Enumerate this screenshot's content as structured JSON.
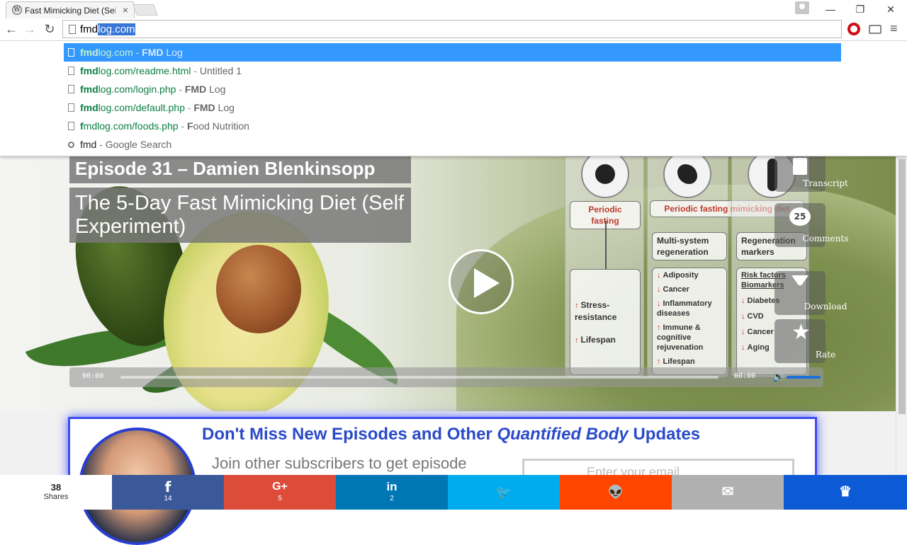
{
  "browser": {
    "tab_title": "Fast Mimicking Diet (Self-",
    "tab_close": "×",
    "favicon_letter": "W",
    "window": {
      "minimize": "—",
      "restore": "❐",
      "close": "✕"
    },
    "nav": {
      "back": "←",
      "forward": "→",
      "reload": "↻"
    },
    "address": {
      "typed": "fmd",
      "completion": "log.com"
    },
    "menu": "≡"
  },
  "suggestions": [
    {
      "bold": "fmd",
      "url_rest": "log.com",
      "sep": " - ",
      "title_bold": "FMD",
      "title_rest": " Log",
      "selected": true
    },
    {
      "bold": "fmd",
      "url_rest": "log.com/readme.html",
      "sep": " - ",
      "title_bold": "",
      "title_rest": "Untitled 1"
    },
    {
      "bold": "fmd",
      "url_rest": "log.com/login.php",
      "sep": " - ",
      "title_bold": "FMD",
      "title_rest": " Log"
    },
    {
      "bold": "fmd",
      "url_rest": "log.com/default.php",
      "sep": " - ",
      "title_bold": "FMD",
      "title_rest": " Log"
    },
    {
      "bold": "f",
      "url_rest": "mdlog.com/foods.php",
      "sep": " - ",
      "title_bold": "F",
      "title_rest": "ood Nutrition"
    }
  ],
  "search_suggestion": {
    "query": "fmd",
    "label": " - Google Search"
  },
  "hero": {
    "episode": "Episode 31 – Damien Blenkinsopp",
    "subtitle": "The 5-Day Fast Mimicking Diet (Self Experiment)",
    "diagram": {
      "col1_head": "Periodic fasting",
      "col23_head": "Periodic fasting mimicking diet",
      "col2_box1": "Multi-system regeneration",
      "col3_box1": "Regeneration markers",
      "col1_items": [
        "Stress-resistance",
        "Lifespan"
      ],
      "col2_items": [
        "Adiposity",
        "Cancer",
        "Inflammatory diseases",
        "Immune & cognitive rejuvenation",
        "Lifespan"
      ],
      "col3_title": "Risk factors Biomarkers",
      "col3_items": [
        "Diabetes",
        "CVD",
        "Cancer",
        "Aging"
      ]
    },
    "side_buttons": {
      "transcript": "Transcript",
      "comments": "Comments",
      "comments_count": "25",
      "download": "Download",
      "rate": "Rate",
      "star": "★"
    },
    "player": {
      "time_current": "00:00",
      "time_total": "00:00",
      "volume_icon": "🔊"
    }
  },
  "subscribe": {
    "heading_pre": "Don't Miss New Episodes and Other ",
    "heading_em": "Quantified Body",
    "heading_post": " Updates",
    "text": "Join other subscribers to get episode",
    "email_placeholder": "Enter your email"
  },
  "share": {
    "total": "38",
    "total_label": "Shares",
    "buttons": [
      {
        "name": "facebook",
        "icon": "f",
        "count": "14",
        "color": "#3b5998"
      },
      {
        "name": "googleplus",
        "icon": "G+",
        "count": "5",
        "color": "#dd4b39"
      },
      {
        "name": "linkedin",
        "icon": "in",
        "count": "2",
        "color": "#0077b5"
      },
      {
        "name": "twitter",
        "icon": "🐦",
        "count": "",
        "color": "#00aced"
      },
      {
        "name": "reddit",
        "icon": "👽",
        "count": "",
        "color": "#ff4500"
      },
      {
        "name": "email",
        "icon": "✉",
        "count": "",
        "color": "#b0b0b0"
      },
      {
        "name": "sumome",
        "icon": "♛",
        "count": "",
        "color": "#0c5ad6"
      }
    ]
  }
}
